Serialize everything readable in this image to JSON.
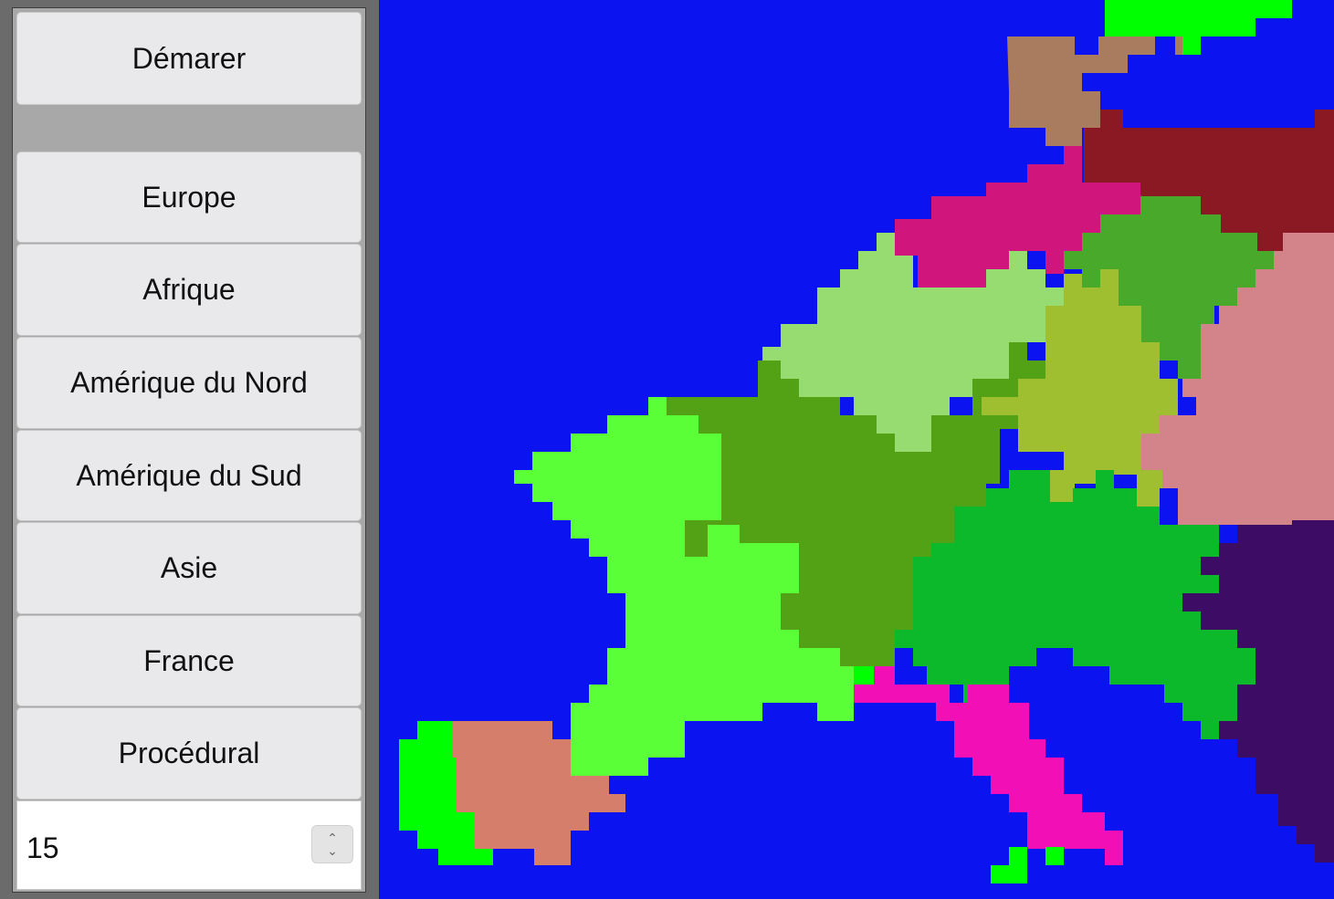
{
  "sidebar": {
    "start_label": "Démarer",
    "maps": [
      {
        "label": "Europe"
      },
      {
        "label": "Afrique"
      },
      {
        "label": "Amérique du Nord"
      },
      {
        "label": "Amérique du Sud"
      },
      {
        "label": "Asie"
      },
      {
        "label": "France"
      },
      {
        "label": "Procédural"
      }
    ],
    "spin_value": "15"
  },
  "map": {
    "ocean_color": "#0a13f0",
    "region_colors": [
      "#5bff38",
      "#d57e6b",
      "#00ff00",
      "#53a114",
      "#97dc70",
      "#0bb92a",
      "#a0bf30",
      "#48a92b",
      "#d2848a",
      "#3d0d66",
      "#f20fb6",
      "#8a1924",
      "#d0157d",
      "#a97b5f"
    ]
  }
}
